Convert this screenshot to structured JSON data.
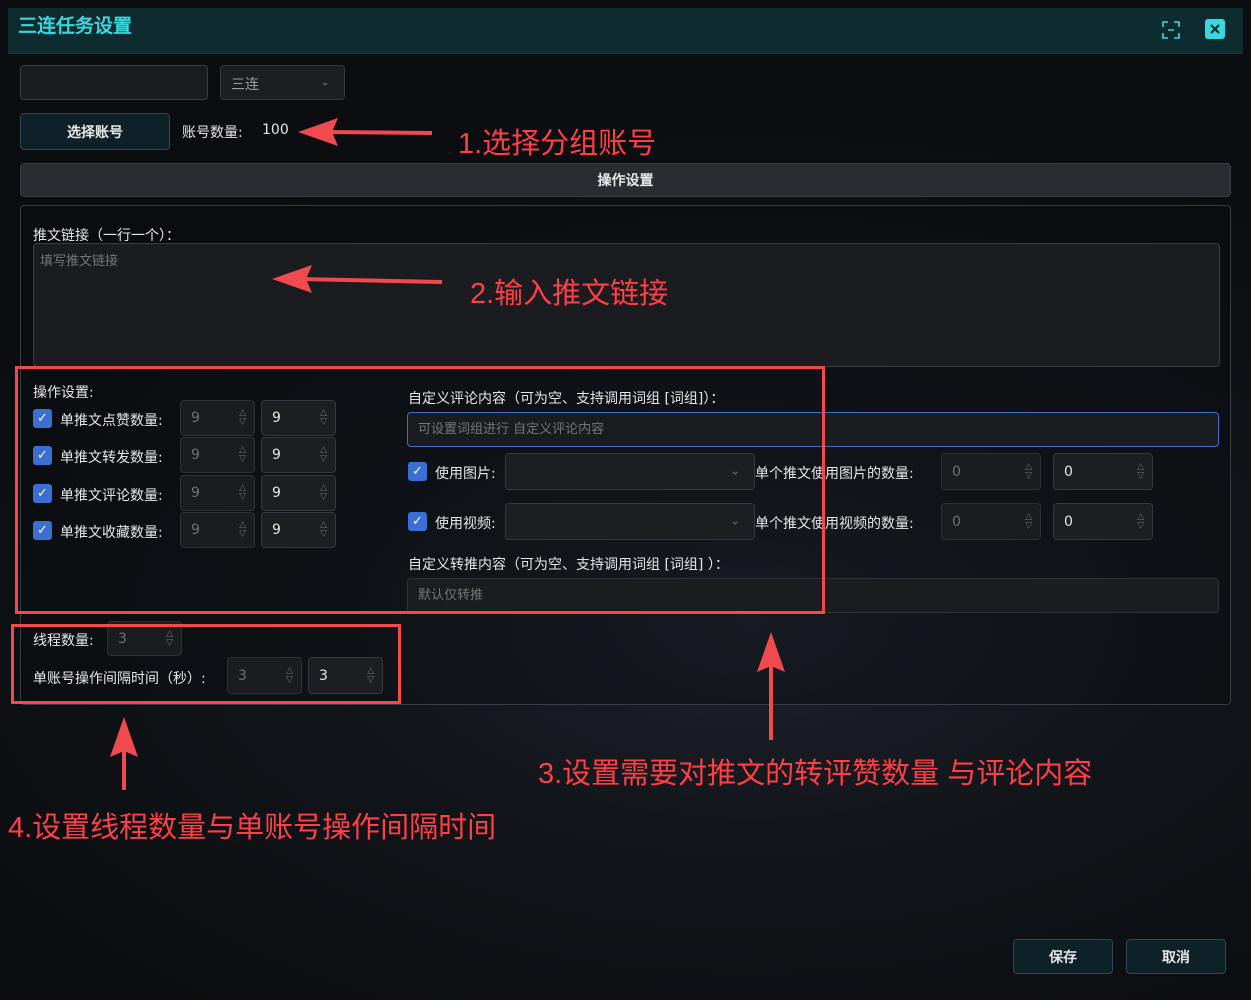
{
  "window": {
    "title": "三连任务设置"
  },
  "group": {
    "name_value": "",
    "type_value": "三连"
  },
  "account": {
    "select_button": "选择账号",
    "count_label": "账号数量:",
    "count_value": "100"
  },
  "section": {
    "tab_label": "操作设置"
  },
  "links": {
    "label": "推文链接（一行一个）：",
    "placeholder": "填写推文链接"
  },
  "ops": {
    "heading": "操作设置:",
    "rows": [
      {
        "label": "单推文点赞数量:",
        "min": "9",
        "max": "9",
        "checked": true
      },
      {
        "label": "单推文转发数量:",
        "min": "9",
        "max": "9",
        "checked": true
      },
      {
        "label": "单推文评论数量:",
        "min": "9",
        "max": "9",
        "checked": true
      },
      {
        "label": "单推文收藏数量:",
        "min": "9",
        "max": "9",
        "checked": true
      }
    ]
  },
  "comment": {
    "label": "自定义评论内容（可为空、支持调用词组 [词组]）：",
    "placeholder": "可设置词组进行 自定义评论内容"
  },
  "media": {
    "image_label": "使用图片:",
    "image_count_label": "单个推文使用图片的数量:",
    "image_min": "0",
    "image_max": "0",
    "video_label": "使用视频:",
    "video_count_label": "单个推文使用视频的数量:",
    "video_min": "0",
    "video_max": "0"
  },
  "retweet": {
    "label": "自定义转推内容（可为空、支持调用词组 [词组] ）：",
    "placeholder": "默认仅转推"
  },
  "thread": {
    "label": "线程数量:",
    "value": "3"
  },
  "interval": {
    "label": "单账号操作间隔时间（秒）:",
    "min": "3",
    "max": "3"
  },
  "footer": {
    "save": "保存",
    "cancel": "取消"
  },
  "annotations": {
    "a1": "1.选择分组账号",
    "a2": "2.输入推文链接",
    "a3": "3.设置需要对推文的转评赞数量 与评论内容",
    "a4": "4.设置线程数量与单账号操作间隔时间"
  },
  "colors": {
    "accent": "#37d8df",
    "annotation": "#f04a4f",
    "checkbox": "#3b6fd4"
  }
}
